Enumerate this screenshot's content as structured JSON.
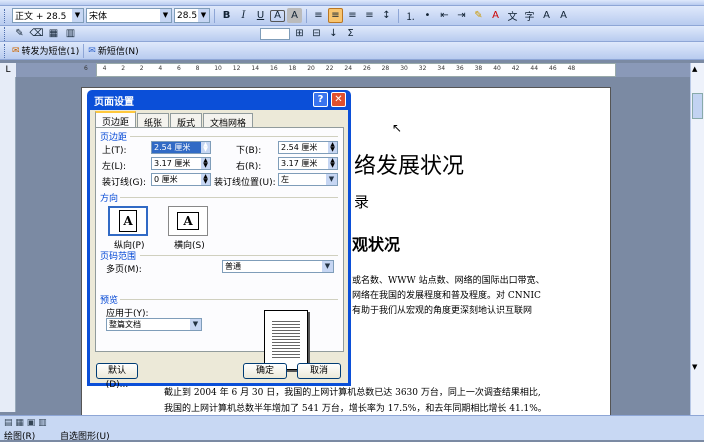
{
  "formatting_toolbar": {
    "style_value": "正文 + 28.5",
    "font_value": "宋体",
    "size_value": "28.5",
    "bold": "B",
    "italic": "I",
    "underline": "U",
    "char_border": "A",
    "char_shade": "A"
  },
  "pdf_toolbar": {
    "convert_label": "转发为短信(1)",
    "new_label": "新短信(N)"
  },
  "ruler": {
    "numbers": [
      "6",
      "4",
      "2",
      "2",
      "4",
      "6",
      "8",
      "10",
      "12",
      "14",
      "16",
      "18",
      "20",
      "22",
      "24",
      "26",
      "28",
      "30",
      "32",
      "34",
      "36",
      "38",
      "40",
      "42",
      "44",
      "46",
      "48"
    ]
  },
  "document": {
    "title_fragment": "络发展状况",
    "subtitle_fragment": "录",
    "heading_fragment": "观状况",
    "para1": [
      "或名数、WWW 站点数、网络的国际出口带宽、",
      "网络在我国的发展程度和普及程度。对 CNNIC",
      "有助于我们从宏观的角度更深刻地认识互联网"
    ],
    "para2": [
      "截止到 2004 年 6 月 30 日，我国的上网计算机总数已达 3630 万台，同上一次调查结果相比,",
      "我国的上网计算机总数半年增加了 541 万台，增长率为 17.5%，和去年同期相比增长 41.1%。"
    ]
  },
  "dialog": {
    "title": "页面设置",
    "tabs": [
      "页边距",
      "纸张",
      "版式",
      "文档网格"
    ],
    "margins_section": "页边距",
    "top_label": "上(T):",
    "top_value": "2.54 厘米",
    "bottom_label": "下(B):",
    "bottom_value": "2.54 厘米",
    "left_label": "左(L):",
    "left_value": "3.17 厘米",
    "right_label": "右(R):",
    "right_value": "3.17 厘米",
    "gutter_label": "装订线(G):",
    "gutter_value": "0 厘米",
    "gutter_pos_label": "装订线位置(U):",
    "gutter_pos_value": "左",
    "orientation_section": "方向",
    "portrait_label": "纵向(P)",
    "landscape_label": "横向(S)",
    "pages_section": "页码范围",
    "multiple_label": "多页(M):",
    "multiple_value": "普通",
    "preview_section": "预览",
    "apply_label": "应用于(Y):",
    "apply_value": "整篇文档",
    "default_button": "默认(D)...",
    "ok_button": "确定",
    "cancel_button": "取消"
  },
  "statusbar": {
    "draw_label": "绘图(R)",
    "autoshapes_label": "自选图形(U)"
  }
}
